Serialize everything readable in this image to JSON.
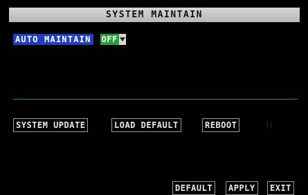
{
  "window": {
    "title": "SYSTEM MAINTAIN"
  },
  "auto_maintain": {
    "label": "AUTO MAINTAIN",
    "value": "OFF",
    "dropdown_icon": "chevron-down-icon"
  },
  "actions": {
    "system_update": "SYSTEM UPDATE",
    "load_default": "LOAD DEFAULT",
    "reboot": "REBOOT"
  },
  "footer": {
    "default": "DEFAULT",
    "apply": "APPLY",
    "exit": "EXIT"
  },
  "colors": {
    "title_bar": "#c8c8c8",
    "label_highlight": "#1e3fbe",
    "select_background": "#1fa43c",
    "divider": "#1f8f36",
    "background": "#010101"
  }
}
